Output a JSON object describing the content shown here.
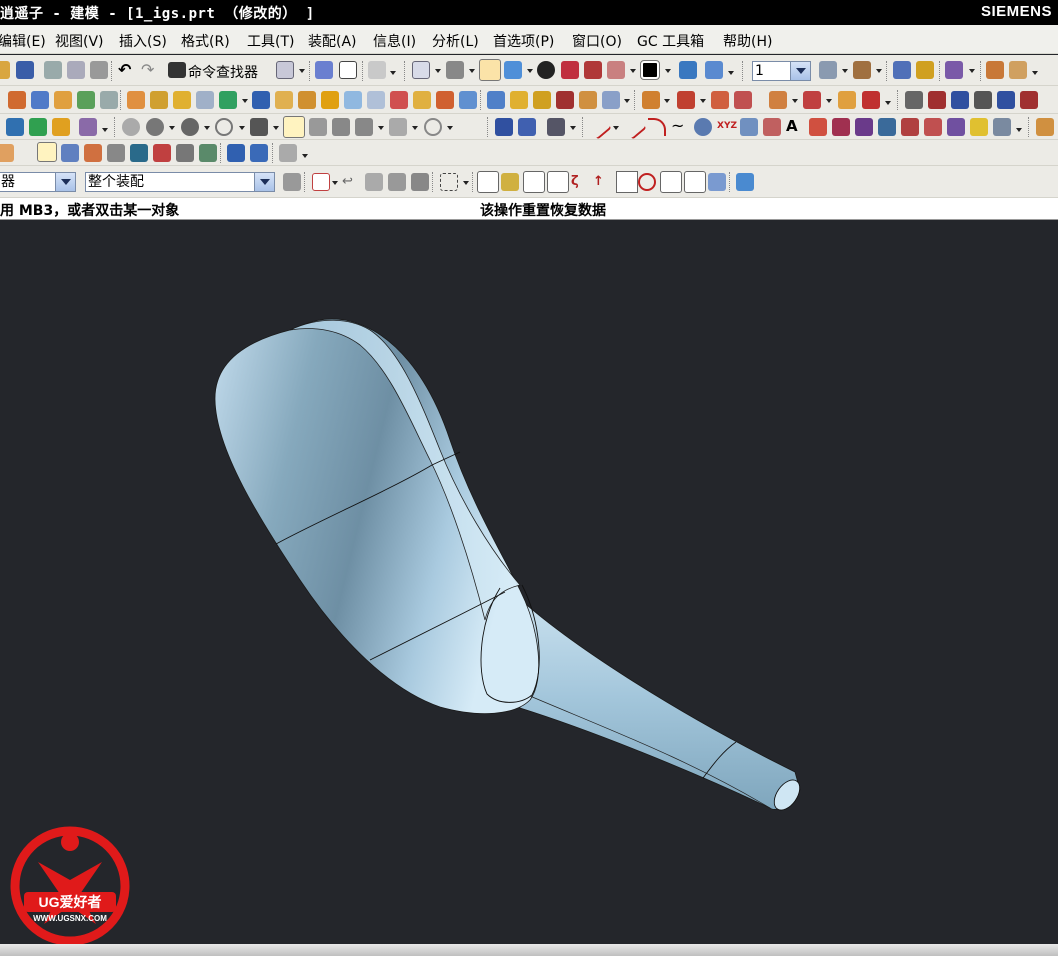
{
  "window": {
    "title": "逍遥子 - 建模 - [1_igs.prt （修改的） ]",
    "brand": "SIEMENS"
  },
  "menu": [
    {
      "id": "edit",
      "label": "编辑(E)"
    },
    {
      "id": "view",
      "label": "视图(V)"
    },
    {
      "id": "insert",
      "label": "插入(S)"
    },
    {
      "id": "format",
      "label": "格式(R)"
    },
    {
      "id": "tools",
      "label": "工具(T)"
    },
    {
      "id": "assembly",
      "label": "装配(A)"
    },
    {
      "id": "info",
      "label": "信息(I)"
    },
    {
      "id": "analysis",
      "label": "分析(L)"
    },
    {
      "id": "preferences",
      "label": "首选项(P)"
    },
    {
      "id": "window",
      "label": "窗口(O)"
    },
    {
      "id": "gc",
      "label": "GC 工具箱"
    },
    {
      "id": "help",
      "label": "帮助(H)"
    }
  ],
  "toolbar": {
    "command_finder": "命令查找器",
    "layer_value": "1"
  },
  "selection_bar": {
    "filter_value": "器",
    "scope_value": "整个装配"
  },
  "status": {
    "prompt": "用 MB3，或者双击某一对象",
    "message": "该操作重置恢复数据"
  },
  "watermark": {
    "text": "UG爱好者",
    "url": "WWW.UGSNX.COM"
  },
  "colors": {
    "model_surface": "#9cc4dc",
    "viewport_bg": "#24262b",
    "logo_red": "#e01a1a"
  }
}
